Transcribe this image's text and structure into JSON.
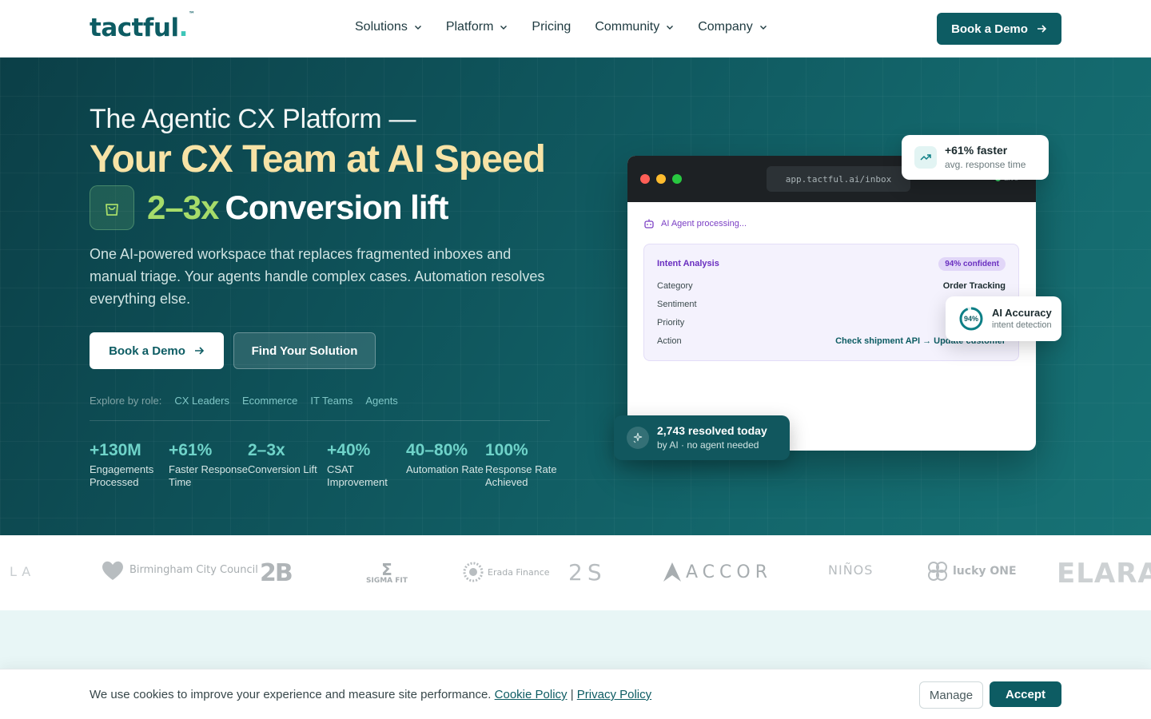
{
  "nav": {
    "logo": "tactful",
    "logo_dot": ".",
    "logo_tm": "™",
    "items": [
      {
        "label": "Solutions",
        "has_dropdown": true
      },
      {
        "label": "Platform",
        "has_dropdown": true
      },
      {
        "label": "Pricing",
        "has_dropdown": false
      },
      {
        "label": "Community",
        "has_dropdown": true
      },
      {
        "label": "Company",
        "has_dropdown": true
      }
    ],
    "cta": "Book a Demo"
  },
  "hero": {
    "kicker": "The Agentic CX Platform —",
    "headline": "Your CX Team at AI Speed",
    "conversion_number": "2–3x",
    "conversion_text": "Conversion lift",
    "subtitle": "One AI-powered workspace that replaces fragmented inboxes and manual triage. Your agents handle complex cases. Automation resolves everything else.",
    "primary_cta": "Book a Demo",
    "secondary_cta": "Find Your Solution",
    "roles_label": "Explore by role:",
    "roles": [
      "CX Leaders",
      "Ecommerce",
      "IT Teams",
      "Agents"
    ],
    "stats": [
      {
        "value": "+130M",
        "label": "Engagements Processed"
      },
      {
        "value": "+61%",
        "label": "Faster Response Time"
      },
      {
        "value": "2–3x",
        "label": "Conversion Lift"
      },
      {
        "value": "+40%",
        "label": "CSAT Improvement"
      },
      {
        "value": "40–80%",
        "label": "Automation Rate"
      },
      {
        "value": "100%",
        "label": "Response Rate Achieved"
      }
    ]
  },
  "mockup": {
    "url": "app.tactful.ai/inbox",
    "live": "Live",
    "processing": "AI Agent processing...",
    "intent_title": "Intent Analysis",
    "confidence": "94% confident",
    "rows": [
      {
        "key": "Category",
        "value": "Order Tracking"
      },
      {
        "key": "Sentiment",
        "value": ""
      },
      {
        "key": "Priority",
        "value": ""
      },
      {
        "key": "Action",
        "value": "Check shipment API → Update customer"
      }
    ]
  },
  "badges": {
    "faster_title": "+61% faster",
    "faster_sub": "avg. response time",
    "accuracy_pct": "94%",
    "accuracy_level": 0.94,
    "accuracy_title": "AI Accuracy",
    "accuracy_sub": "intent detection",
    "resolved_title": "2,743 resolved today",
    "resolved_sub": "by AI · no agent needed"
  },
  "logos": {
    "items": [
      "LA",
      "Birmingham City Council",
      "2B",
      "SIGMA FIT",
      "Erada Finance",
      "2S",
      "ACCOR",
      "NIÑOS",
      "lucky ONE",
      "ELARA"
    ]
  },
  "cookie": {
    "message": "We use cookies to improve your experience and measure site performance.",
    "cookie_policy": "Cookie Policy",
    "separator": "|",
    "privacy_policy": "Privacy Policy",
    "manage": "Manage",
    "accept": "Accept"
  },
  "colors": {
    "brand": "#0d5c63",
    "accent_gold": "#f7e3a6",
    "accent_green": "#a6dc6a",
    "stat_teal": "#6fd3c9"
  }
}
